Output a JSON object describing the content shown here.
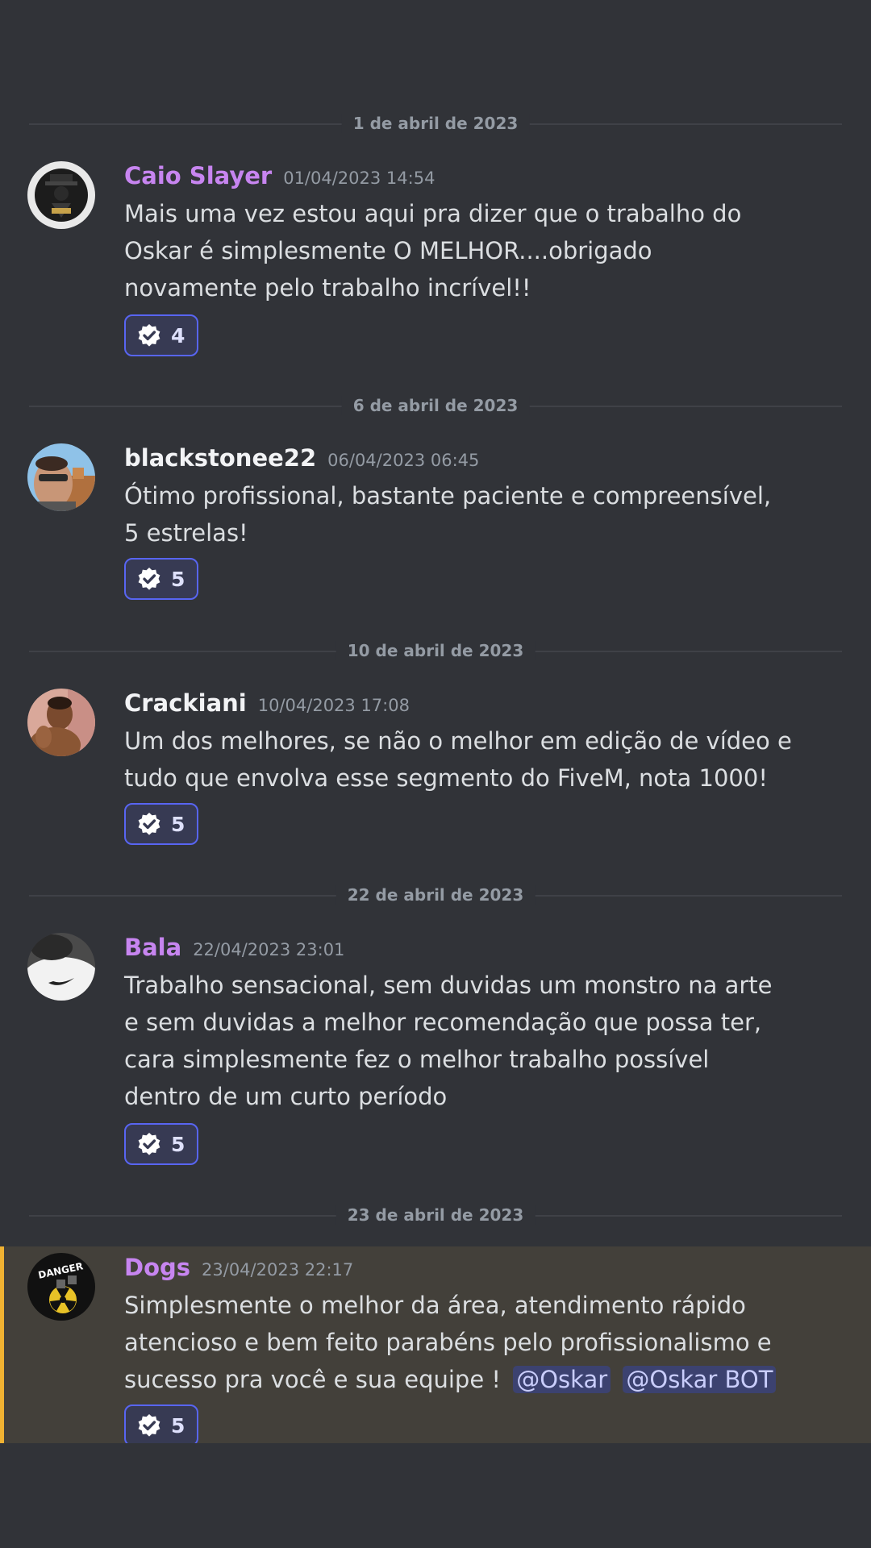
{
  "colors": {
    "background": "#313338",
    "username_purple": "#c785f0",
    "username_white": "#f2f3f5",
    "timestamp": "#949ba4",
    "message_text": "#dbdee1",
    "reaction_border": "#5865f2",
    "highlight_bar": "#f0b232"
  },
  "messages": [
    {
      "date_divider": "1 de abril de 2023",
      "username": "Caio Slayer",
      "username_color": "purple",
      "timestamp": "01/04/2023 14:54",
      "lines": [
        "Mais uma vez estou aqui pra dizer que o trabalho do",
        "Oskar é simplesmente O MELHOR....obrigado",
        "novamente pelo trabalho incrível!!"
      ],
      "reaction": {
        "icon": "verified-check-icon",
        "count": "4"
      }
    },
    {
      "date_divider": "6 de abril de 2023",
      "username": "blackstonee22",
      "username_color": "white",
      "timestamp": "06/04/2023 06:45",
      "lines": [
        "Ótimo profissional, bastante paciente e compreensível,",
        "5 estrelas!"
      ],
      "reaction": {
        "icon": "verified-check-icon",
        "count": "5"
      }
    },
    {
      "date_divider": "10 de abril de 2023",
      "username": "Crackiani",
      "username_color": "white",
      "timestamp": "10/04/2023 17:08",
      "lines": [
        "Um dos melhores, se não o melhor em edição de vídeo e",
        "tudo que envolva esse segmento do FiveM, nota 1000!"
      ],
      "reaction": {
        "icon": "verified-check-icon",
        "count": "5"
      }
    },
    {
      "date_divider": "22 de abril de 2023",
      "username": "Bala",
      "username_color": "purple",
      "timestamp": "22/04/2023 23:01",
      "lines": [
        "Trabalho sensacional, sem duvidas um monstro na arte",
        "e sem duvidas a melhor recomendação que possa ter,",
        "cara simplesmente fez o melhor trabalho possível",
        "dentro de um curto período"
      ],
      "reaction": {
        "icon": "verified-check-icon",
        "count": "5"
      }
    },
    {
      "date_divider": "23 de abril de 2023",
      "username": "Dogs",
      "username_color": "purple",
      "timestamp": "23/04/2023 22:17",
      "lines": [
        "Simplesmente o melhor da área, atendimento rápido",
        "atencioso e bem feito parabéns pelo profissionalismo e",
        "sucesso pra você e sua equipe !"
      ],
      "mentions": [
        "@Oskar",
        "@Oskar BOT"
      ],
      "avatar_text": "DANGER",
      "reaction": {
        "icon": "verified-check-icon",
        "count": "5"
      }
    }
  ]
}
